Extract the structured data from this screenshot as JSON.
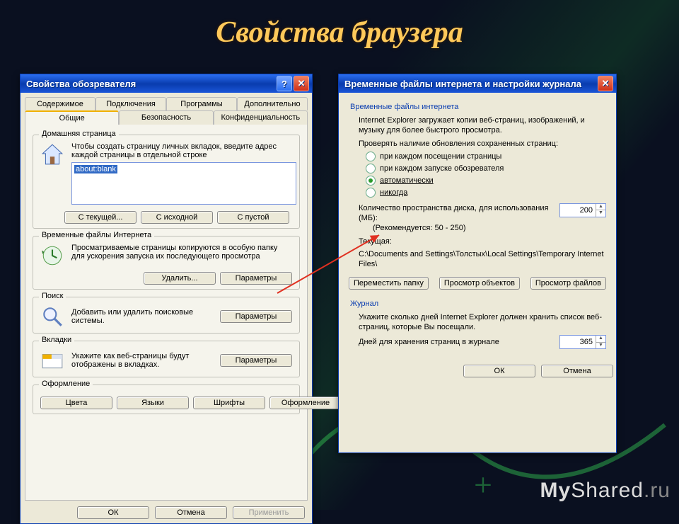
{
  "slide": {
    "title": "Свойства браузера"
  },
  "win1": {
    "title": "Свойства обозревателя",
    "tabs_row1": [
      "Содержимое",
      "Подключения",
      "Программы",
      "Дополнительно"
    ],
    "tabs_row2": [
      "Общие",
      "Безопасность",
      "Конфиденциальность"
    ],
    "active_tab": "Общие",
    "home": {
      "legend": "Домашняя страница",
      "hint": "Чтобы создать страницу личных вкладок, введите адрес каждой страницы в отдельной строке",
      "value": "about:blank",
      "buttons": [
        "С текущей...",
        "С исходной",
        "С пустой"
      ]
    },
    "temp": {
      "legend": "Временные файлы Интернета",
      "hint": "Просматриваемые страницы копируются в особую папку для ускорения запуска их последующего просмотра",
      "buttons": [
        "Удалить...",
        "Параметры"
      ]
    },
    "search": {
      "legend": "Поиск",
      "hint": "Добавить или удалить поисковые системы.",
      "button": "Параметры"
    },
    "tabs_group": {
      "legend": "Вкладки",
      "hint": "Укажите как веб-страницы будут отображены в вкладках.",
      "button": "Параметры"
    },
    "style": {
      "legend": "Оформление",
      "buttons": [
        "Цвета",
        "Языки",
        "Шрифты",
        "Оформление"
      ]
    },
    "dialog_buttons": {
      "ok": "ОК",
      "cancel": "Отмена",
      "apply": "Применить"
    }
  },
  "win2": {
    "title": "Временные файлы интернета и настройки журнала",
    "temp": {
      "heading": "Временные файлы интернета",
      "line1": "Internet Explorer загружает копии веб-страниц, изображений, и музыку для более быстрого просмотра.",
      "line2": "Проверять наличие обновления сохраненных страниц:",
      "radios": [
        "при каждом посещении страницы",
        "при каждом запуске обозревателя",
        "автоматически",
        "никогда"
      ],
      "selected": 2,
      "disk_label": "Количество пространства диска, для использования (МБ):",
      "disk_hint": "(Рекомендуется: 50 - 250)",
      "disk_value": "200",
      "current_label": "Текущая:",
      "current_path": "C:\\Documents and Settings\\Толстых\\Local Settings\\Temporary Internet Files\\",
      "buttons": [
        "Переместить папку",
        "Просмотр объектов",
        "Просмотр файлов"
      ]
    },
    "journal": {
      "heading": "Журнал",
      "hint": "Укажите сколько дней Internet Explorer должен хранить список веб-страниц, которые Вы посещали.",
      "days_label": "Дней для хранения страниц в журнале",
      "days_value": "365"
    },
    "dialog_buttons": {
      "ok": "ОК",
      "cancel": "Отмена"
    }
  },
  "watermark": {
    "left": "My",
    "mid": "Shared",
    "right": ".ru"
  }
}
